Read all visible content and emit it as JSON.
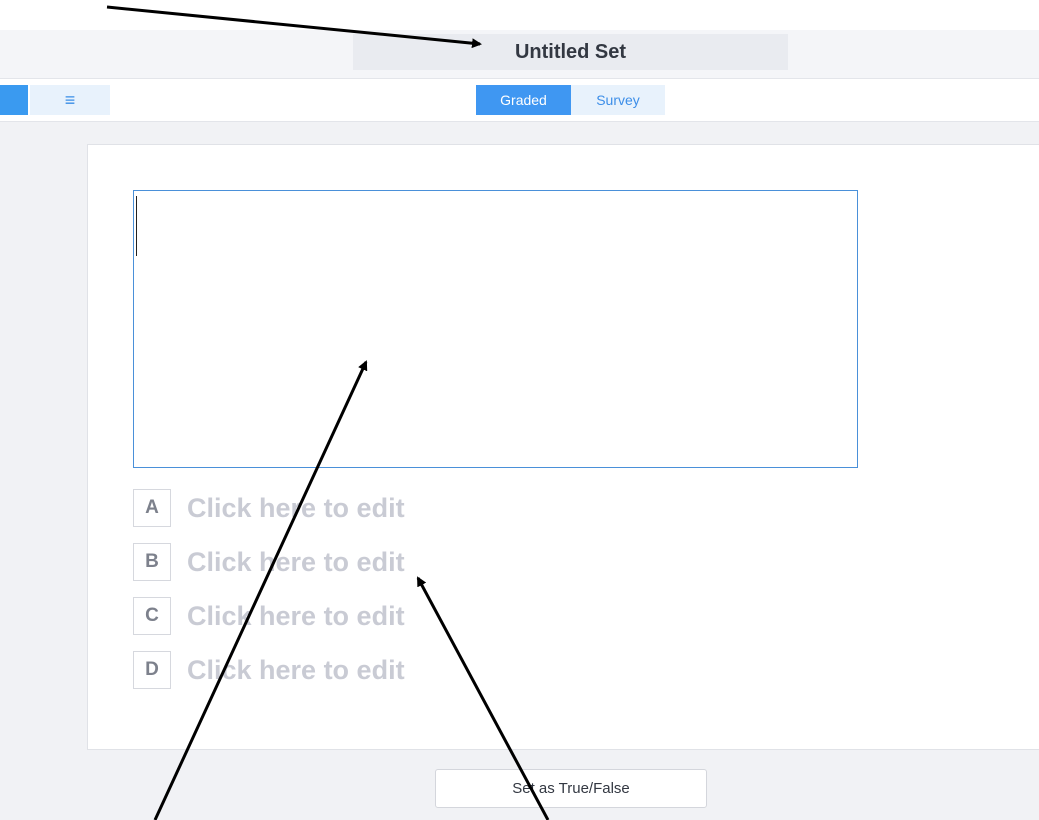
{
  "header": {
    "title": "Untitled Set"
  },
  "toolbar": {
    "menu_icon": "hamburger-menu-icon",
    "modes": [
      {
        "label": "Graded",
        "active": true
      },
      {
        "label": "Survey",
        "active": false
      }
    ]
  },
  "question": {
    "text": ""
  },
  "answers": [
    {
      "letter": "A",
      "placeholder": "Click here to edit"
    },
    {
      "letter": "B",
      "placeholder": "Click here to edit"
    },
    {
      "letter": "C",
      "placeholder": "Click here to edit"
    },
    {
      "letter": "D",
      "placeholder": "Click here to edit"
    }
  ],
  "actions": {
    "true_false_label": "Set as True/False"
  },
  "colors": {
    "accent": "#3f97f2",
    "accent_light": "#e8f2fc",
    "background": "#f1f2f5",
    "placeholder_text": "#c9cbd4"
  }
}
